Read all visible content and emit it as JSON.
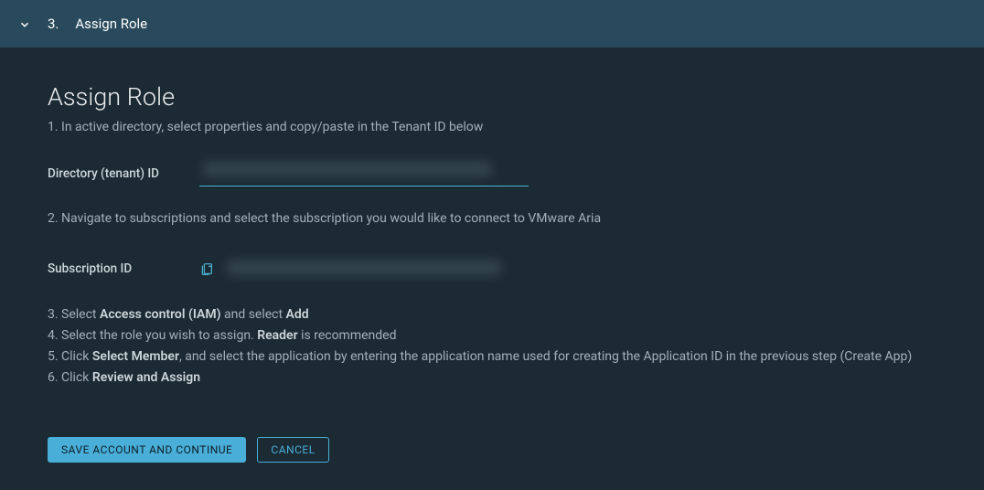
{
  "header": {
    "step_number": "3.",
    "step_title": "Assign Role"
  },
  "page": {
    "title": "Assign Role",
    "instruction1": "1. In active directory, select properties and copy/paste in the Tenant ID below",
    "directory_label": "Directory (tenant) ID",
    "directory_value": "",
    "instruction2": "2. Navigate to subscriptions and select the subscription you would like to connect to VMware Aria",
    "subscription_label": "Subscription ID",
    "subscription_value": "",
    "instruction3_prefix": "3. Select ",
    "instruction3_bold1": "Access control (IAM)",
    "instruction3_mid": " and select ",
    "instruction3_bold2": "Add",
    "instruction4_prefix": "4. Select the role you wish to assign. ",
    "instruction4_bold": "Reader",
    "instruction4_suffix": " is recommended",
    "instruction5_prefix": "5. Click ",
    "instruction5_bold": "Select Member",
    "instruction5_suffix": ", and select the application by entering the application name used for creating the Application ID in the previous step (Create App)",
    "instruction6_prefix": "6. Click ",
    "instruction6_bold": "Review and Assign"
  },
  "buttons": {
    "save": "SAVE ACCOUNT AND CONTINUE",
    "cancel": "CANCEL"
  }
}
